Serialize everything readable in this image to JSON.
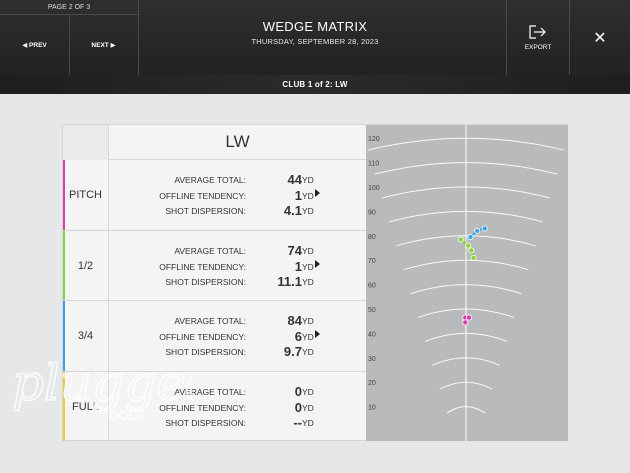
{
  "header": {
    "page_indicator": "PAGE 2 OF 3",
    "prev_label": "◀ PREV",
    "next_label": "NEXT ▶",
    "title": "WEDGE MATRIX",
    "date": "THURSDAY, SEPTEMBER 28, 2023",
    "export_label": "EXPORT",
    "close_label": "✕"
  },
  "subbar": {
    "club_indicator": "CLUB 1 of 2: LW"
  },
  "table": {
    "club_name": "LW",
    "rows": [
      {
        "label": "PITCH",
        "accent": "#d63cad",
        "stats": [
          {
            "label": "AVERAGE TOTAL:",
            "value": "44",
            "unit": "YD"
          },
          {
            "label": "OFFLINE TENDENCY:",
            "value": "1",
            "unit": "YD"
          },
          {
            "label": "SHOT DISPERSION:",
            "value": "4.1",
            "unit": "YD"
          }
        ]
      },
      {
        "label": "1/2",
        "accent": "#8ad339",
        "stats": [
          {
            "label": "AVERAGE TOTAL:",
            "value": "74",
            "unit": "YD"
          },
          {
            "label": "OFFLINE TENDENCY:",
            "value": "1",
            "unit": "YD"
          },
          {
            "label": "SHOT DISPERSION:",
            "value": "11.1",
            "unit": "YD"
          }
        ]
      },
      {
        "label": "3/4",
        "accent": "#3aa3e8",
        "stats": [
          {
            "label": "AVERAGE TOTAL:",
            "value": "84",
            "unit": "YD"
          },
          {
            "label": "OFFLINE TENDENCY:",
            "value": "6",
            "unit": "YD"
          },
          {
            "label": "SHOT DISPERSION:",
            "value": "9.7",
            "unit": "YD"
          }
        ]
      },
      {
        "label": "FULL",
        "accent": "#e8cf3a",
        "stats": [
          {
            "label": "AVERAGE TOTAL:",
            "value": "0",
            "unit": "YD"
          },
          {
            "label": "OFFLINE TENDENCY:",
            "value": "0",
            "unit": "YD"
          },
          {
            "label": "SHOT DISPERSION:",
            "value": "--",
            "unit": "YD"
          }
        ]
      }
    ]
  },
  "chart_data": {
    "type": "scatter",
    "y_ticks": [
      "120",
      "110",
      "100",
      "90",
      "80",
      "70",
      "60",
      "50",
      "40",
      "30",
      "20",
      "10"
    ],
    "ylim": [
      0,
      125
    ],
    "series": [
      {
        "color": "#3aa3e8",
        "points": [
          [
            2.5,
            83
          ],
          [
            1.5,
            82
          ],
          [
            0.6,
            79.5
          ]
        ]
      },
      {
        "color": "#8ad339",
        "points": [
          [
            -0.7,
            78.5
          ],
          [
            0.3,
            76
          ],
          [
            0.7,
            74
          ],
          [
            1.0,
            71
          ]
        ]
      },
      {
        "color": "#d63cad",
        "points": [
          [
            -0.1,
            46.5
          ],
          [
            0.4,
            46.5
          ],
          [
            -0.1,
            44.5
          ]
        ]
      }
    ]
  },
  "watermark": {
    "text": "plugged in",
    "sub": "GOLF"
  }
}
